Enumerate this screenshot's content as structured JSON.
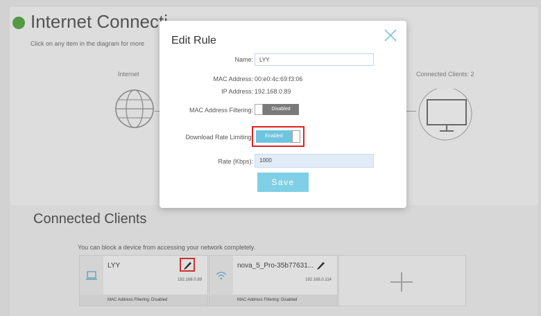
{
  "background": {
    "title": "Internet Connecti",
    "hint": "Click on any item in the diagram for more",
    "internet_label": "Internet",
    "connected_clients_label": "Connected Clients: 2",
    "clients_section_title": "Connected Clients",
    "block_hint": "You can block a device from accessing your network completely.",
    "clients": [
      {
        "name": "LYY",
        "ip": "192.168.0.89",
        "footer": "MAC Address Filtering: Disabled",
        "icon": "laptop-icon"
      },
      {
        "name": "nova_5_Pro-35b77631...",
        "ip": "192.168.0.114",
        "footer": "MAC Address Filtering: Disabled",
        "icon": "wifi-icon"
      }
    ],
    "colors": {
      "status_green": "#4ba23a",
      "highlight_red": "#e02020"
    }
  },
  "modal": {
    "title": "Edit Rule",
    "close_icon": "close-icon",
    "fields": {
      "name_label": "Name:",
      "name_value": "LYY",
      "mac_label": "MAC Address:",
      "mac_value": "00:e0:4c:69:f3:06",
      "ip_label": "IP Address:",
      "ip_value": "192.168.0.89",
      "mac_filter_label": "MAC Address Filtering:",
      "mac_filter_value": "Disabled",
      "rate_limit_label": "Download Rate Limiting:",
      "rate_limit_value": "Enabled",
      "rate_label": "Rate (Kbps):",
      "rate_value": "1000"
    },
    "save_label": "Save",
    "colors": {
      "accent": "#7fd0e6",
      "enabled": "#6ec5df",
      "disabled": "#7a7a7a"
    }
  }
}
